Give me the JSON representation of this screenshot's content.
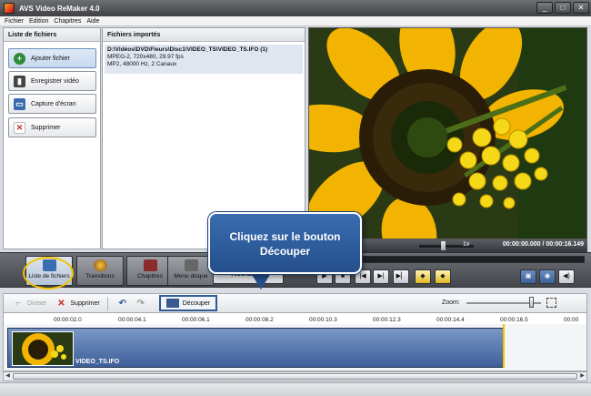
{
  "window": {
    "title": "AVS Video ReMaker 4.0",
    "controls": [
      "_",
      "□",
      "✕"
    ]
  },
  "menu": {
    "items": [
      "Fichier",
      "Edition",
      "Chapitres",
      "Aide"
    ]
  },
  "left_panel": {
    "header": "Liste de fichiers",
    "buttons": [
      {
        "label": "Ajouter fichier",
        "icon": "add-icon",
        "color": "#2e8b3a"
      },
      {
        "label": "Enregistrer vidéo",
        "icon": "film-save-icon",
        "color": "#444444"
      },
      {
        "label": "Capture d'écran",
        "icon": "screen-capture-icon",
        "color": "#3a6bb0"
      },
      {
        "label": "Supprimer",
        "icon": "delete-icon",
        "color": "#c62828"
      }
    ]
  },
  "imported": {
    "header": "Fichiers importés",
    "file": {
      "path": "D:\\Vidéos\\DVD\\Fleurs\\Disc1\\VIDEO_TS\\VIDEO_TS.IFO (1)",
      "video": "MPEG-2, 720x480, 29.97 fps",
      "audio": "MP2, 48000 Hz, 2 Canaux"
    }
  },
  "player": {
    "speed": "1x",
    "timecode": "00:00:00.000 / 00:00:16.149"
  },
  "modes": [
    {
      "label": "Liste de fichiers",
      "icon": "file-list-icon",
      "active": true
    },
    {
      "label": "Transitions",
      "icon": "transitions-icon",
      "active": false
    },
    {
      "label": "Chapitres",
      "icon": "chapters-icon",
      "active": false
    },
    {
      "label": "Menu disque",
      "icon": "disc-menu-icon",
      "active": false
    }
  ],
  "retraiter_label": "Retraiter!",
  "edit_toolbar": {
    "diviser": "Diviser",
    "supprimer": "Supprimer",
    "decouper": "Découper",
    "zoom": "Zoom:"
  },
  "timeline": {
    "ticks": [
      "00:00:02.0",
      "00:00:04.1",
      "00:00:06.1",
      "00:00:08.2",
      "00:00:10.3",
      "00:00:12.3",
      "00:00:14.4",
      "00:00:16.5",
      "00:00"
    ],
    "clip_label": "VIDEO_TS.IFO"
  },
  "callout": {
    "line1": "Cliquez sur le bouton",
    "line2": "Découper"
  },
  "colors": {
    "accent": "#2e5b94",
    "highlight": "#f2c200",
    "clip": "#4d6ca6"
  }
}
